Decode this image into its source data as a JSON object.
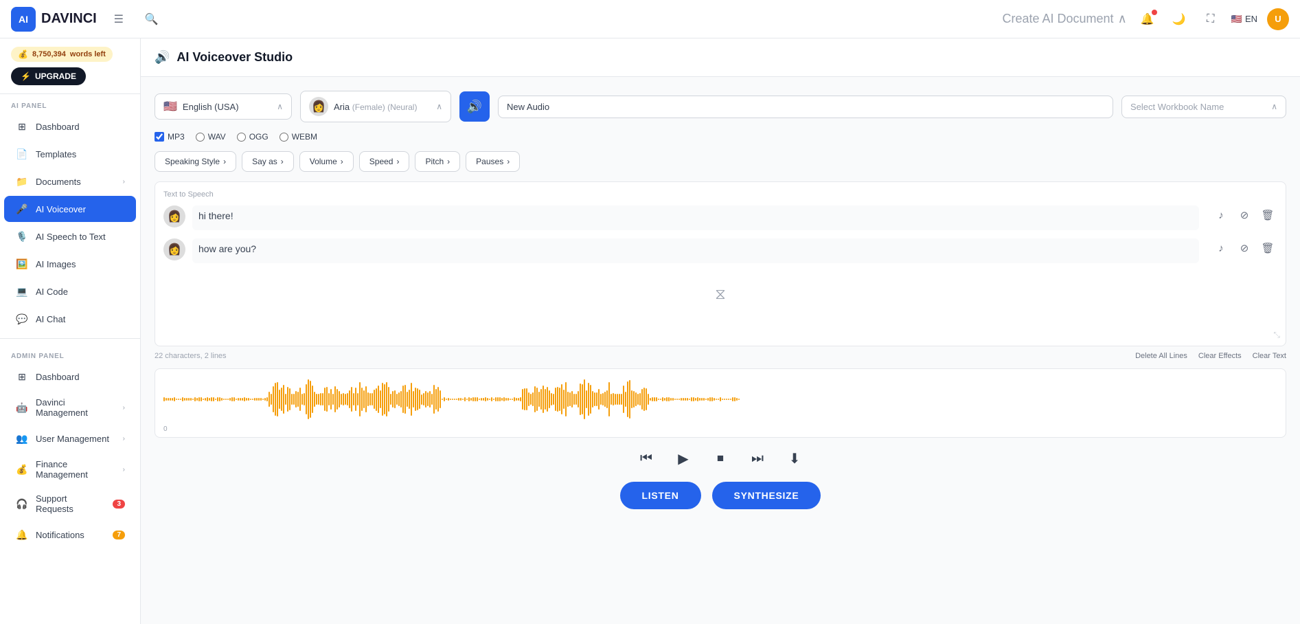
{
  "app": {
    "name": "DAVINCI",
    "logo_letter": "AI"
  },
  "topnav": {
    "create_label": "Create AI Document",
    "lang": "EN",
    "user_initials": "U"
  },
  "sidebar": {
    "words_left": "8,750,394",
    "words_suffix": " words left",
    "upgrade_label": "UPGRADE",
    "ai_panel_label": "AI PANEL",
    "admin_panel_label": "ADMIN PANEL",
    "items": [
      {
        "id": "dashboard",
        "label": "Dashboard",
        "icon": "⊞",
        "active": false
      },
      {
        "id": "templates",
        "label": "Templates",
        "icon": "📄",
        "active": false
      },
      {
        "id": "documents",
        "label": "Documents",
        "icon": "📁",
        "active": false,
        "chevron": true
      },
      {
        "id": "ai-voiceover",
        "label": "AI Voiceover",
        "icon": "🎤",
        "active": true
      },
      {
        "id": "ai-speech",
        "label": "AI Speech to Text",
        "icon": "🎙️",
        "active": false
      },
      {
        "id": "ai-images",
        "label": "AI Images",
        "icon": "🖼️",
        "active": false
      },
      {
        "id": "ai-code",
        "label": "AI Code",
        "icon": "💻",
        "active": false
      },
      {
        "id": "ai-chat",
        "label": "AI Chat",
        "icon": "💬",
        "active": false
      }
    ],
    "admin_items": [
      {
        "id": "admin-dashboard",
        "label": "Dashboard",
        "icon": "⊞",
        "active": false
      },
      {
        "id": "davinci-management",
        "label": "Davinci Management",
        "icon": "🤖",
        "active": false,
        "chevron": true
      },
      {
        "id": "user-management",
        "label": "User Management",
        "icon": "👥",
        "active": false,
        "chevron": true
      },
      {
        "id": "finance-management",
        "label": "Finance Management",
        "icon": "💰",
        "active": false,
        "chevron": true
      },
      {
        "id": "support-requests",
        "label": "Support Requests",
        "icon": "🎧",
        "active": false,
        "badge": "3",
        "badge_type": "red"
      },
      {
        "id": "notifications",
        "label": "Notifications",
        "icon": "🔔",
        "active": false,
        "badge": "7",
        "badge_type": "orange"
      }
    ]
  },
  "studio": {
    "icon": "🔊",
    "title": "AI Voiceover Studio",
    "language": "English (USA)",
    "flag": "🇺🇸",
    "voice_name": "Aria",
    "voice_gender": "(Female)",
    "voice_type": "(Neural)",
    "audio_name": "New Audio",
    "workbook_placeholder": "Select Workbook Name",
    "formats": [
      "MP3",
      "WAV",
      "OGG",
      "WEBM"
    ],
    "active_format": "MP3",
    "effects": [
      {
        "id": "speaking-style",
        "label": "Speaking Style",
        "arrow": "›"
      },
      {
        "id": "say-as",
        "label": "Say as",
        "arrow": "›"
      },
      {
        "id": "volume",
        "label": "Volume",
        "arrow": "›"
      },
      {
        "id": "speed",
        "label": "Speed",
        "arrow": "›"
      },
      {
        "id": "pitch",
        "label": "Pitch",
        "arrow": "›"
      },
      {
        "id": "pauses",
        "label": "Pauses",
        "arrow": "›"
      }
    ],
    "editor_label": "Text to Speech",
    "lines": [
      {
        "id": 1,
        "text": "hi there!",
        "avatar": "👩"
      },
      {
        "id": 2,
        "text": "how are you?",
        "avatar": "👩"
      }
    ],
    "char_count": "22 characters, 2 lines",
    "editor_actions": [
      "Delete All Lines",
      "Clear Effects",
      "Clear Text"
    ],
    "transport": {
      "rewind": "⏮",
      "play": "▶",
      "stop": "⏹",
      "forward": "⏭",
      "download": "⬇"
    },
    "timeline_markers": [
      "0",
      "",
      "",
      ""
    ],
    "listen_label": "LISTEN",
    "synthesize_label": "SYNTHESIZE"
  }
}
